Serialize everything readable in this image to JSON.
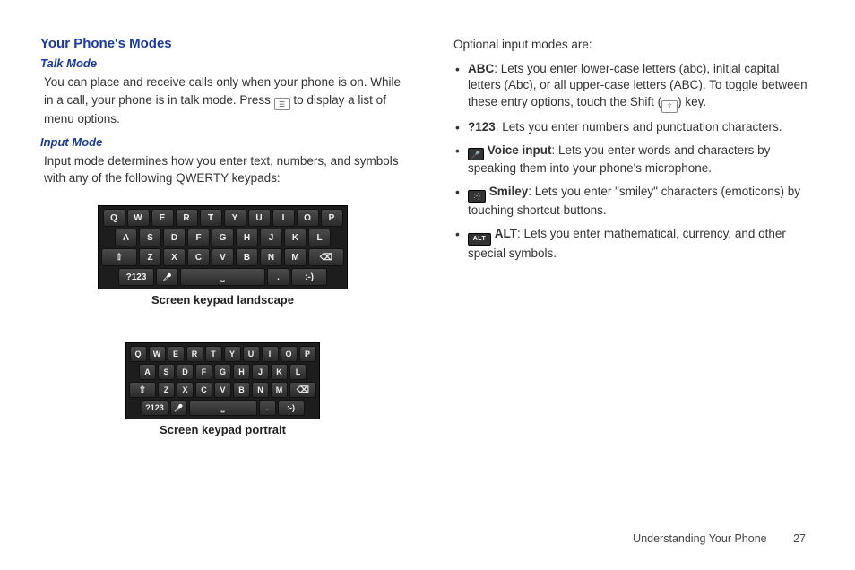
{
  "left": {
    "sectionTitle": "Your Phone's Modes",
    "talkHeading": "Talk Mode",
    "talkBody1": "You can place and receive calls only when your phone is on. While in a call, your phone is in talk mode. Press ",
    "talkBody2": " to display a list of menu options.",
    "inputHeading": "Input Mode",
    "inputBody": "Input mode determines how you enter text, numbers, and symbols with any of the following QWERTY keypads:",
    "caption1": "Screen keypad landscape",
    "caption2": "Screen keypad portrait",
    "kbRow1": [
      "Q",
      "W",
      "E",
      "R",
      "T",
      "Y",
      "U",
      "I",
      "O",
      "P"
    ],
    "kbRow2": [
      "A",
      "S",
      "D",
      "F",
      "G",
      "H",
      "J",
      "K",
      "L"
    ],
    "kbRow3mid": [
      "Z",
      "X",
      "C",
      "V",
      "B",
      "N",
      "M"
    ],
    "kb123": "?123",
    "kbDot": ".",
    "kbSmiley": ":-)"
  },
  "right": {
    "intro": "Optional input modes are:",
    "abcLabel": "ABC",
    "abcText1": ": Lets you enter lower-case letters (abc), initial capital letters (Abc), or all upper-case letters (ABC). To toggle between these entry options, touch the Shift (",
    "abcText2": ") key.",
    "n123Label": "?123",
    "n123Text": ": Lets you enter numbers and punctuation characters.",
    "voiceLabel": "Voice input",
    "voiceText": ": Lets you enter words and characters by speaking them into your phone's microphone.",
    "smileyLabel": "Smiley",
    "smileyText": ": Lets you enter \"smiley\" characters (emoticons) by touching shortcut buttons.",
    "altLabel": "ALT",
    "altText": ": Lets you enter mathematical, currency, and other special symbols."
  },
  "footer": {
    "section": "Understanding Your Phone",
    "page": "27"
  }
}
